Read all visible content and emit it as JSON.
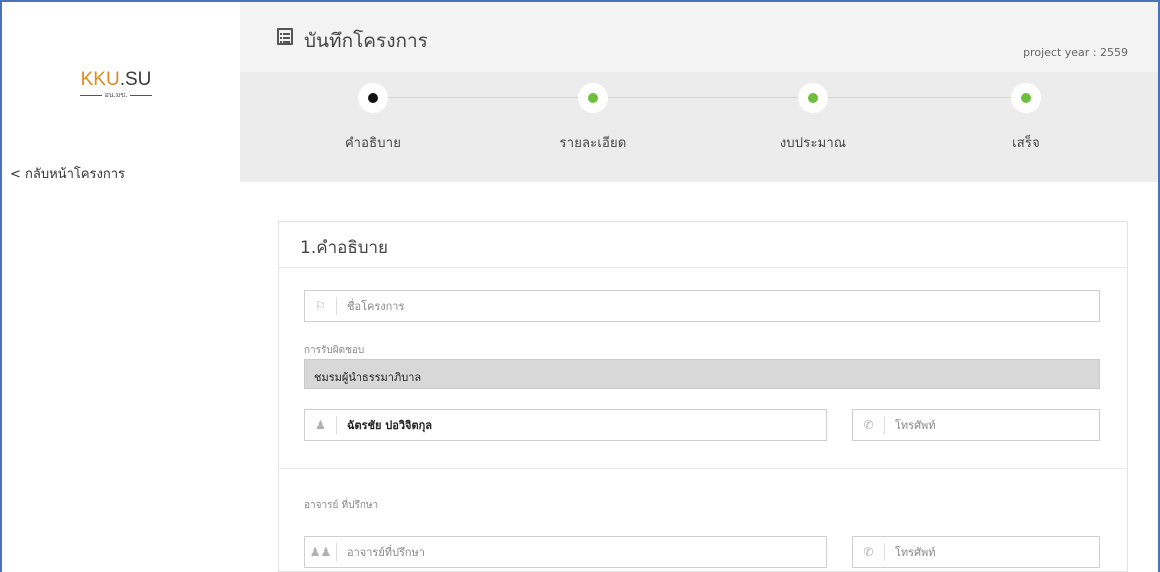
{
  "sidebar": {
    "logo_main_kku": "KKU",
    "logo_main_su": ".SU",
    "logo_sub": "อน.มข.",
    "back_link": "< กลับหน้าโครงการ"
  },
  "header": {
    "title": "บันทึกโครงการ",
    "project_year": "project year : 2559",
    "icon": "list-page-icon"
  },
  "wizard": {
    "steps": [
      {
        "label": "คำอธิบาย",
        "state": "active"
      },
      {
        "label": "รายละเอียด",
        "state": "done"
      },
      {
        "label": "งบประมาณ",
        "state": "done"
      },
      {
        "label": "เสร็จ",
        "state": "done"
      }
    ],
    "colors": {
      "active": "#111111",
      "done": "#6bbf3a"
    }
  },
  "form": {
    "section_title": "1.คำอธิบาย",
    "project_name": {
      "placeholder": "ชื่อโครงการ",
      "icon": "flag-icon"
    },
    "responsible": {
      "label": "การรับผิดชอบ",
      "value": "ชมรมผู้นำธรรมาภิบาล"
    },
    "person": {
      "value": "ฉัตรชัย ปอวิจิตกุล",
      "icon": "user-icon"
    },
    "person_phone": {
      "placeholder": "โทรศัพท์",
      "icon": "phone-icon"
    },
    "advisor_label": "อาจารย์ ที่ปรึกษา",
    "advisor": {
      "placeholder": "อาจารย์ที่ปรึกษา",
      "icon": "group-icon"
    },
    "advisor_phone": {
      "placeholder": "โทรศัพท์",
      "icon": "phone-icon"
    }
  }
}
